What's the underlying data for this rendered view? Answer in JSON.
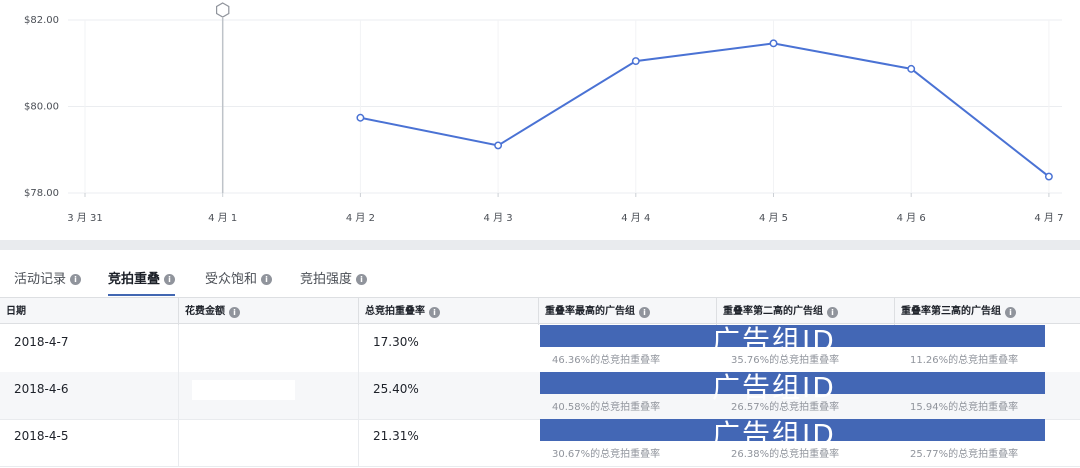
{
  "chart_data": {
    "type": "line",
    "categories": [
      "3 月 31",
      "4 月 1",
      "4 月 2",
      "4 月 3",
      "4 月 4",
      "4 月 5",
      "4 月 6",
      "4 月 7"
    ],
    "values": [
      null,
      null,
      79.74,
      79.1,
      81.05,
      81.46,
      80.87,
      78.38
    ],
    "yticks": [
      "$82.00",
      "$80.00",
      "$78.00"
    ],
    "ylim": [
      78,
      82
    ],
    "marker_category": "4 月 1",
    "color": "#4a72d4",
    "grid": true
  },
  "tabs": [
    {
      "label": "活动记录",
      "active": false
    },
    {
      "label": "竞拍重叠",
      "active": true
    },
    {
      "label": "受众饱和",
      "active": false
    },
    {
      "label": "竞拍强度",
      "active": false
    }
  ],
  "table": {
    "headers": [
      "日期",
      "花费金额",
      "总竞拍重叠率",
      "重叠率最高的广告组",
      "重叠率第二高的广告组",
      "重叠率第三高的广告组"
    ],
    "rows": [
      {
        "date": "2018-4-7",
        "overlap": "17.30%",
        "top1": "46.36%的总竞拍重叠率",
        "top2": "35.76%的总竞拍重叠率",
        "top3": "11.26%的总竞拍重叠率"
      },
      {
        "date": "2018-4-6",
        "overlap": "25.40%",
        "top1": "40.58%的总竞拍重叠率",
        "top2": "26.57%的总竞拍重叠率",
        "top3": "15.94%的总竞拍重叠率"
      },
      {
        "date": "2018-4-5",
        "overlap": "21.31%",
        "top1": "30.67%的总竞拍重叠率",
        "top2": "26.38%的总竞拍重叠率",
        "top3": "25.77%的总竞拍重叠率"
      }
    ],
    "watermark": "广告组ID",
    "info_glyph": "i"
  }
}
